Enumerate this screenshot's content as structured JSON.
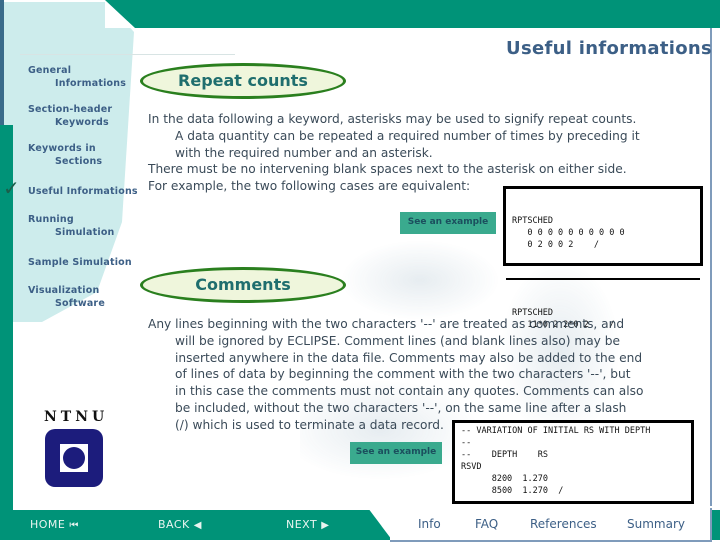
{
  "header": {
    "title": "Useful informations"
  },
  "sidebar": {
    "items": [
      {
        "line1": "General",
        "line2": "Informations",
        "active": false
      },
      {
        "line1": "Section-header",
        "line2": "Keywords",
        "active": false
      },
      {
        "line1": "Keywords in",
        "line2": "Sections",
        "active": false
      },
      {
        "line1": "Useful Informations",
        "line2": "",
        "active": true
      },
      {
        "line1": "Running",
        "line2": "Simulation",
        "active": false
      },
      {
        "line1": "Sample Simulation",
        "line2": "",
        "active": false
      },
      {
        "line1": "Visualization",
        "line2": "Software",
        "active": false
      }
    ],
    "check_icon": "✓",
    "logo_text": "NTNU"
  },
  "sections": {
    "repeat": {
      "title": "Repeat counts",
      "lines": [
        "In the data following a keyword, asterisks may be used to signify repeat counts.",
        "A data quantity can be repeated a required number of times by preceding it",
        "with the required number and an asterisk.",
        "There must be no intervening blank spaces next to the asterisk on either side.",
        "For example, the two following cases are equivalent:"
      ],
      "example_button": "See an example",
      "code_a": "RPTSCHED\n   0 0 0 0 0 0 0 0 0 0\n   0 2 0 0 2    /",
      "code_b": "RPTSCHED\n   11*0 2 2*0 2    /"
    },
    "comments": {
      "title": "Comments",
      "lines": [
        "Any lines beginning with the two characters '--' are treated as comments, and",
        "will be ignored by ECLIPSE. Comment lines (and blank lines also) may be",
        "inserted anywhere in the data file. Comments may also be added to the end",
        "of lines of data by beginning the comment with the two characters '--', but",
        "in this case the comments must not contain any quotes. Comments can also",
        "be included, without the two characters '--', on the same line after a slash",
        "(/) which is used to terminate a data record."
      ],
      "example_button": "See an example",
      "code": "-- VARIATION OF INITIAL RS WITH DEPTH\n--\n--    DEPTH    RS\nRSVD\n      8200  1.270\n      8500  1.270  /"
    }
  },
  "footer": {
    "home": "HOME",
    "home_icon": "⏮",
    "back": "BACK",
    "back_icon": "◀",
    "next": "NEXT",
    "next_icon": "▶",
    "links": [
      "Info",
      "FAQ",
      "References",
      "Summary"
    ]
  }
}
